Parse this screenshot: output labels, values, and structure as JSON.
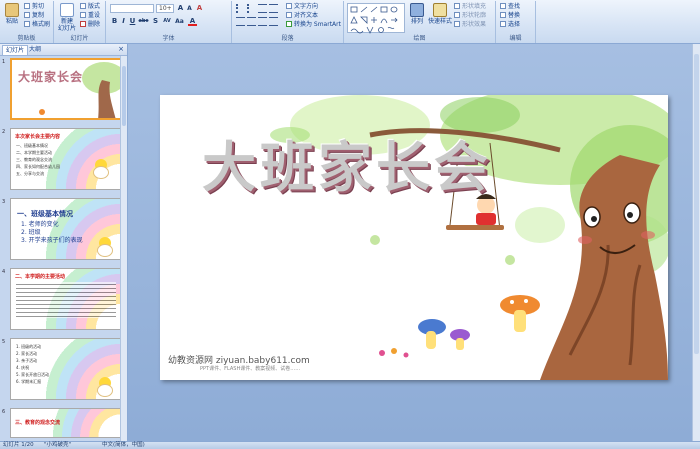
{
  "ribbon": {
    "clipboard": {
      "paste": "粘贴",
      "cut": "剪切",
      "copy": "复制",
      "format_painter": "格式刷",
      "label": "剪贴板"
    },
    "slides": {
      "new_slide": "新建\n幻灯片",
      "layout": "版式",
      "reset": "重设",
      "delete": "删除",
      "label": "幻灯片"
    },
    "font": {
      "font_name": "",
      "font_size": "10+",
      "grow": "A",
      "shrink": "A",
      "clear": "A",
      "bold": "B",
      "italic": "I",
      "underline": "U",
      "strike": "abc",
      "shadow": "S",
      "spacing": "AV",
      "case": "Aa",
      "color": "A",
      "label": "字体"
    },
    "paragraph": {
      "text_direction": "文字方向",
      "align_text": "对齐文本",
      "smartart": "转换为 SmartArt",
      "label": "段落"
    },
    "drawing": {
      "arrange": "排列",
      "quick_styles": "快速样式",
      "fill": "形状填充",
      "outline": "形状轮廓",
      "effects": "形状效果",
      "label": "绘图"
    },
    "editing": {
      "find": "查找",
      "replace": "替换",
      "select": "选择",
      "label": "编辑"
    }
  },
  "left_pane": {
    "tabs": [
      "幻灯片",
      "大纲"
    ],
    "close": "×",
    "thumbnails": [
      {
        "num": "1",
        "title": "大班家长会"
      },
      {
        "num": "2",
        "title": "本次家长会主要内容",
        "lines": [
          "一、班级基本情况",
          "二、本学期主要活动",
          "三、教育的观念交流",
          "四、家长如何配合幼儿园",
          "五、分享与交流"
        ]
      },
      {
        "num": "3",
        "title": "一、班级基本情况",
        "lines": [
          "1. 老师的变化",
          "2. 班级",
          "3. 开学来孩子们的表现"
        ]
      },
      {
        "num": "4",
        "title": "二、本学期的主要活动"
      },
      {
        "num": "5",
        "lines": [
          "1. 班级的活动",
          "2. 家长活动",
          "3. 亲子活动",
          "4. 庆祝",
          "5. 家长开放日活动",
          "6. 学期末汇报"
        ]
      },
      {
        "num": "6",
        "title": "三、教育的观念交流"
      }
    ]
  },
  "slide": {
    "title": "大班家长会",
    "footer": "幼教资源网 ziyuan.baby611.com",
    "footer_sub": "PPT课件、FLASH课件、教案视频、试卷……"
  },
  "status": {
    "slide_info": "幻灯片 1/20",
    "theme": "\"小鸡破壳\"",
    "language": "中文(简体，中国)"
  },
  "colors": {
    "ribbon_bg": "#d7e4f5",
    "title_shadow": "#a06070",
    "selected_border": "#f0a030"
  }
}
